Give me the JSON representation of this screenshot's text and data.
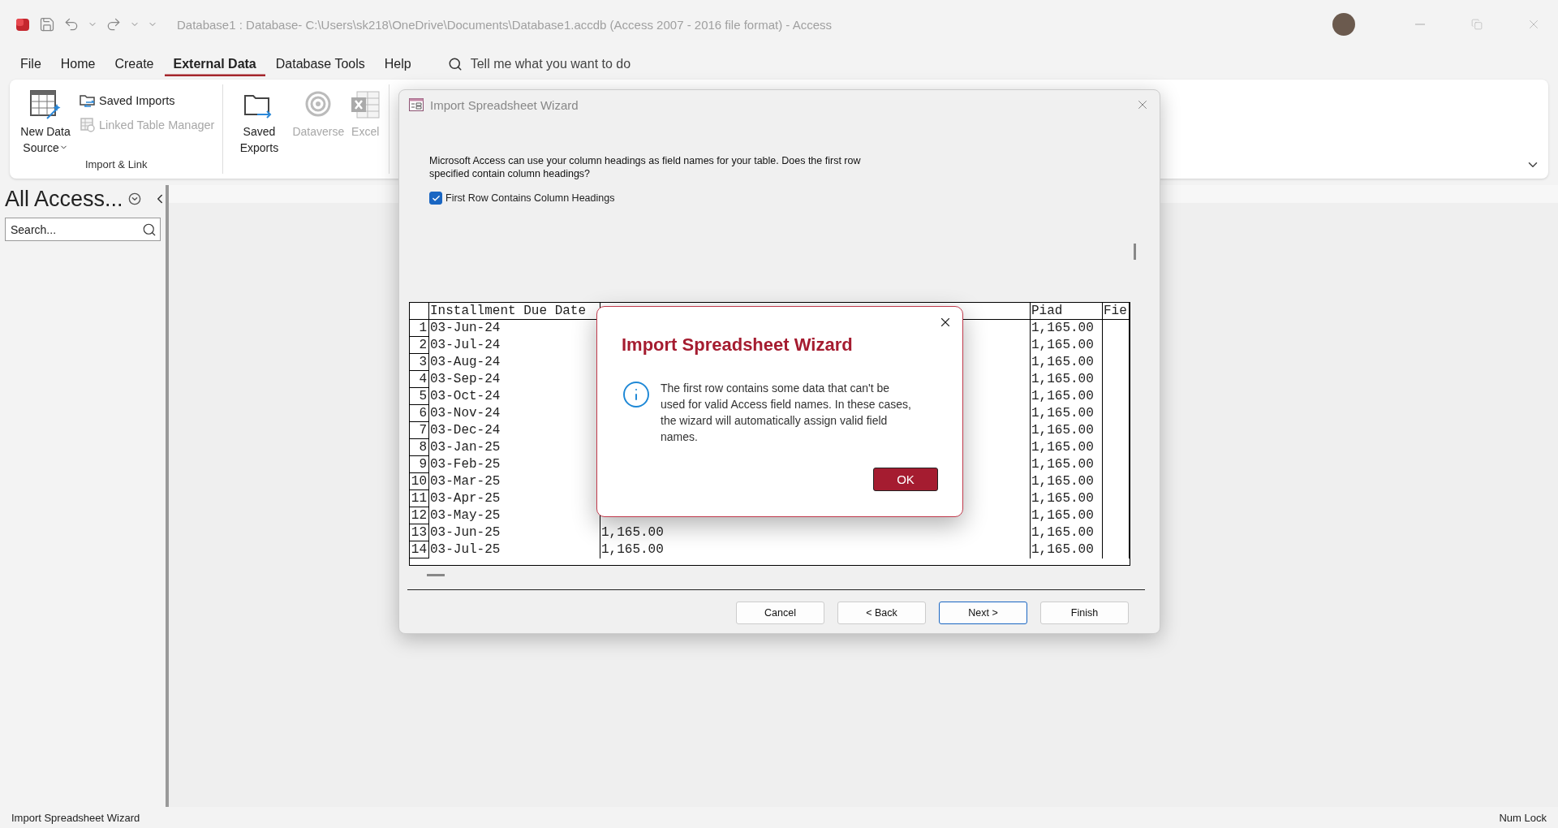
{
  "window": {
    "title": "Database1 : Database- C:\\Users\\sk218\\OneDrive\\Documents\\Database1.accdb (Access 2007 - 2016 file format)  -  Access"
  },
  "ribbon_tabs": [
    {
      "label": "File",
      "selected": false
    },
    {
      "label": "Home",
      "selected": false
    },
    {
      "label": "Create",
      "selected": false
    },
    {
      "label": "External Data",
      "selected": true
    },
    {
      "label": "Database Tools",
      "selected": false
    },
    {
      "label": "Help",
      "selected": false
    }
  ],
  "tell_me": {
    "placeholder": "Tell me what you want to do"
  },
  "ribbon_groups": [
    {
      "label": "Import & Link",
      "commands": [
        {
          "label": "New Data Source",
          "kind": "large",
          "disabled": false,
          "dropdown": true
        },
        {
          "label": "Saved Imports",
          "kind": "small",
          "disabled": false
        },
        {
          "label": "Linked Table Manager",
          "kind": "small",
          "disabled": true
        }
      ]
    },
    {
      "commands": [
        {
          "label": "Saved Exports",
          "kind": "large",
          "disabled": false
        },
        {
          "label": "Dataverse",
          "kind": "large",
          "disabled": true
        },
        {
          "label": "Excel",
          "kind": "large",
          "disabled": true
        }
      ]
    }
  ],
  "navigation_pane": {
    "title": "All Access...",
    "search": {
      "placeholder": "Search..."
    }
  },
  "wizard": {
    "title": "Import Spreadsheet Wizard",
    "instructions": "Microsoft Access can use your column headings as field names for your table. Does the first row specified contain column headings?",
    "checkbox": {
      "label": "First Row Contains Column Headings",
      "checked": true
    },
    "grid": {
      "columns": [
        "Installment Due Date",
        null,
        "Piad",
        "Fie"
      ],
      "rows": [
        {
          "number": "1",
          "cells": [
            "03-Jun-24",
            null,
            "1,165.00",
            null
          ]
        },
        {
          "number": "2",
          "cells": [
            "03-Jul-24",
            null,
            "1,165.00",
            null
          ]
        },
        {
          "number": "3",
          "cells": [
            "03-Aug-24",
            null,
            "1,165.00",
            null
          ]
        },
        {
          "number": "4",
          "cells": [
            "03-Sep-24",
            null,
            "1,165.00",
            null
          ]
        },
        {
          "number": "5",
          "cells": [
            "03-Oct-24",
            null,
            "1,165.00",
            null
          ]
        },
        {
          "number": "6",
          "cells": [
            "03-Nov-24",
            null,
            "1,165.00",
            null
          ]
        },
        {
          "number": "7",
          "cells": [
            "03-Dec-24",
            null,
            "1,165.00",
            null
          ]
        },
        {
          "number": "8",
          "cells": [
            "03-Jan-25",
            null,
            "1,165.00",
            null
          ]
        },
        {
          "number": "9",
          "cells": [
            "03-Feb-25",
            null,
            "1,165.00",
            null
          ]
        },
        {
          "number": "10",
          "cells": [
            "03-Mar-25",
            null,
            "1,165.00",
            null
          ]
        },
        {
          "number": "11",
          "cells": [
            "03-Apr-25",
            null,
            "1,165.00",
            null
          ]
        },
        {
          "number": "12",
          "cells": [
            "03-May-25",
            null,
            "1,165.00",
            null
          ]
        },
        {
          "number": "13",
          "cells": [
            "03-Jun-25",
            "1,165.00",
            "1,165.00",
            null
          ]
        },
        {
          "number": "14",
          "cells": [
            "03-Jul-25",
            "1,165.00",
            "1,165.00",
            null
          ]
        }
      ]
    },
    "buttons": [
      {
        "label": "Cancel",
        "focused": false
      },
      {
        "label": "< Back",
        "focused": false
      },
      {
        "label": "Next >",
        "focused": true
      },
      {
        "label": "Finish",
        "focused": false
      }
    ]
  },
  "message_box": {
    "title": "Import Spreadsheet Wizard",
    "message": "The first row contains some data that can't be used for valid Access field names. In these cases, the wizard will automatically assign valid field names.",
    "button": "OK"
  },
  "status_bar": {
    "left": "Import Spreadsheet Wizard",
    "right": "Num Lock"
  }
}
